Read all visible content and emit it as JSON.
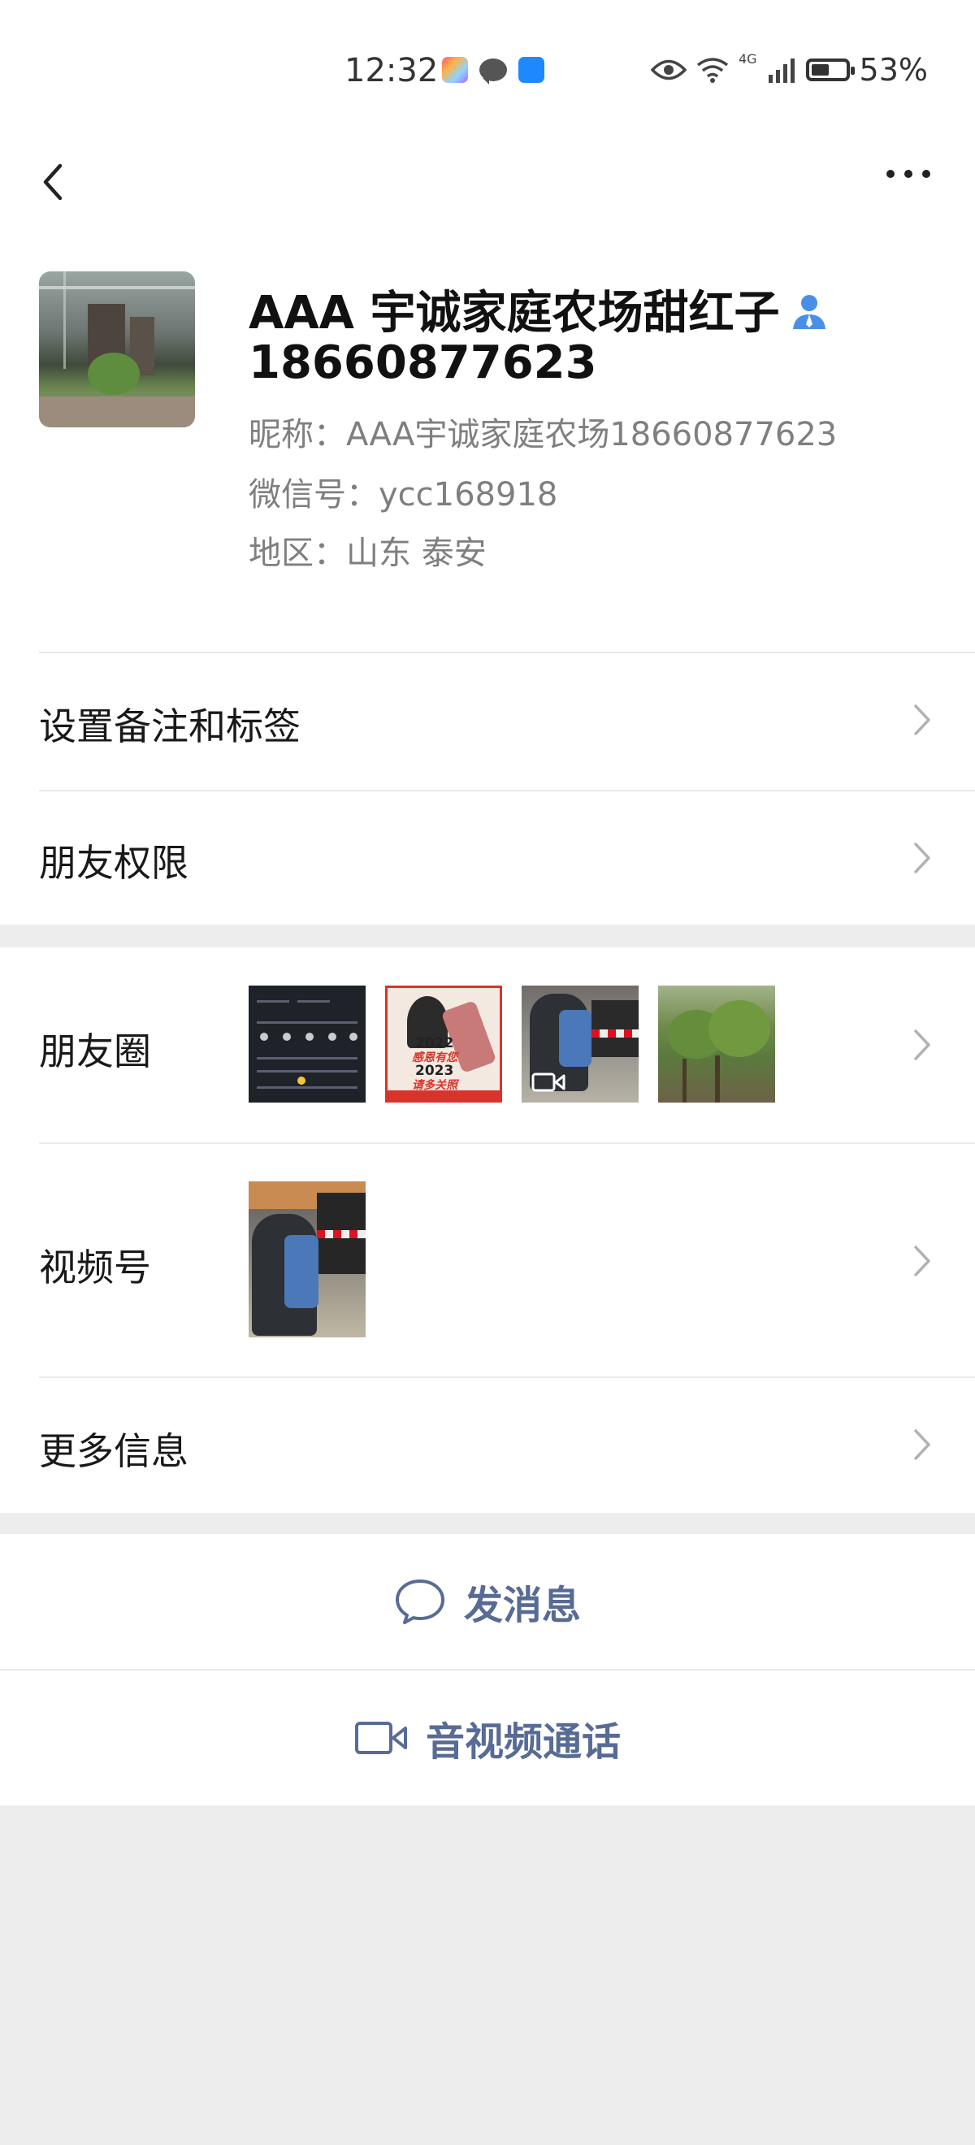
{
  "status_bar": {
    "time": "12:32",
    "network": "4G",
    "battery_percent": "53%",
    "battery_level": 0.53
  },
  "nav": {
    "back_icon": "chevron-left-icon",
    "more_icon": "more-dots-icon"
  },
  "profile": {
    "name": "AAA 宇诚家庭农场甜红子",
    "name_line2": "18660877623",
    "contact_icon": "person-icon",
    "nickname": "昵称：AAA宇诚家庭农场18660877623",
    "wechat_id": "微信号：ycc168918",
    "region": "地区：山东  泰安"
  },
  "menu": {
    "set_remark": "设置备注和标签",
    "friend_permission": "朋友权限",
    "moments": "朋友圈",
    "channels": "视频号",
    "more_info": "更多信息"
  },
  "moments_thumb_text": {
    "line1": "2022",
    "line2": "感恩有您",
    "line3": "2023",
    "line4": "请多关照"
  },
  "actions": {
    "send_message": "发消息",
    "video_call": "音视频通话"
  },
  "colors": {
    "link_blue": "#576b95",
    "background": "#ededed",
    "contact_icon_blue": "#4a8fe7"
  }
}
